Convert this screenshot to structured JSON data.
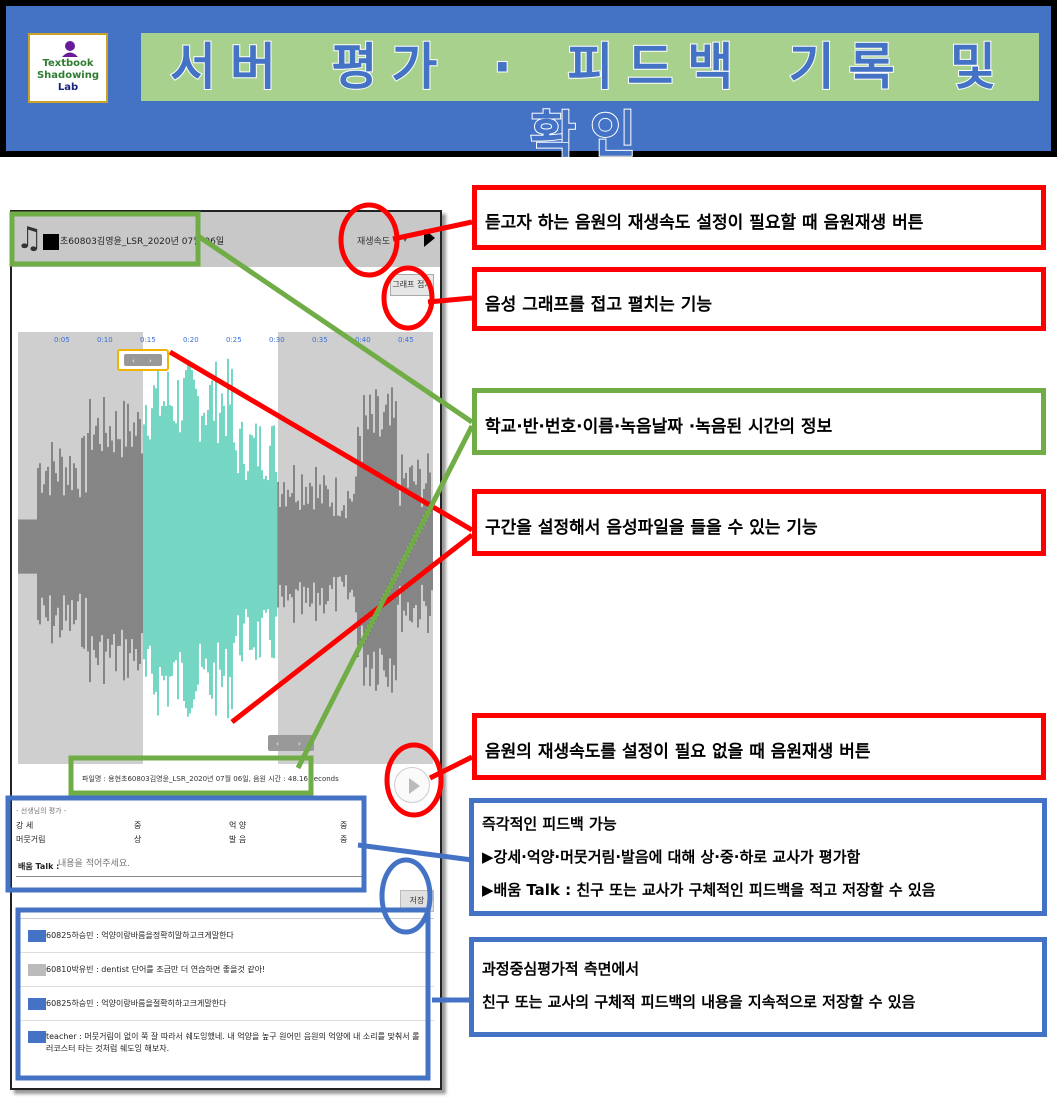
{
  "header": {
    "logo_lines": [
      "Textbook",
      "Shadowing",
      "Lab"
    ],
    "title": "서버 평가 · 피드백 기록 및 확인"
  },
  "app": {
    "file_info": "초60803김영윤_LSR_2020년 07월 06일",
    "speed_label": "재생속도",
    "speed_caret": "▼",
    "fold_button": "그래프 접기",
    "time_ticks": [
      "0:05",
      "0:10",
      "0:15",
      "0:20",
      "0:25",
      "0:30",
      "0:35",
      "0:40",
      "0:45"
    ],
    "file_caption": "파일명 : 용현초60803김영윤_LSR_2020년 07월 06일,   음원 시간 : 48.16 seconds",
    "evaluation": {
      "legend": "- 선생님의 평가 -",
      "rows": [
        {
          "item1": "강    세",
          "grade1": "중",
          "item2": "억    양",
          "grade2": "중"
        },
        {
          "item1": "머뭇거림",
          "grade1": "상",
          "item2": "발    음",
          "grade2": "중"
        }
      ],
      "talk_label": "배움 Talk :",
      "talk_placeholder": "내용을 적어주세요."
    },
    "save_button": "저장",
    "comments": [
      "60825하승민 : 억양이랑바름을정확히말하고크게말한다",
      "60810박유빈 : dentist 단어를 조금만 더 연습하면 좋을것 같아!",
      "60825하승민 : 억양이랑바름을절확히하고크게말한다",
      "teacher : 머뭇거림이 없이 쭉 잘 따라서 쉐도잉했네. 내 억양을 높구 원어민 음원의 억양에 내 소리를 맞춰서 롤러코스터 타는 것처럼 쉐도잉 해보자."
    ]
  },
  "callouts": {
    "speed_play": "듣고자 하는 음원의 재생속도 설정이 필요할 때 음원재생 버튼",
    "fold_graph": "음성 그래프를 접고 펼치는 기능",
    "info": "학교·반·번호·이름·녹음날짜 ·녹음된 시간의 정보",
    "section": "구간을 설정해서 음성파일을 들을 수 있는 기능",
    "no_speed_play": "음원의 재생속도를 설정이 필요 없을 때 음원재생 버튼",
    "feedback": [
      "즉각적인 피드백 가능",
      "▶강세·억양·머뭇거림·발음에 대해 상·중·하로 교사가 평가함",
      "▶배움 Talk : 친구 또는 교사가 구체적인 피드백을 적고 저장할 수 있음"
    ],
    "process": [
      "과정중심평가적 측면에서",
      "친구 또는 교사의 구체적 피드백의 내용을 지속적으로 저장할 수 있음"
    ]
  },
  "colors": {
    "header_blue": "#4472c4",
    "title_green": "#a9d18e",
    "callout_red": "#ff0000",
    "callout_green": "#70ad47",
    "callout_blue": "#4472c4",
    "wave_selected": "#1abc9c",
    "wave_unselected": "#555555"
  }
}
